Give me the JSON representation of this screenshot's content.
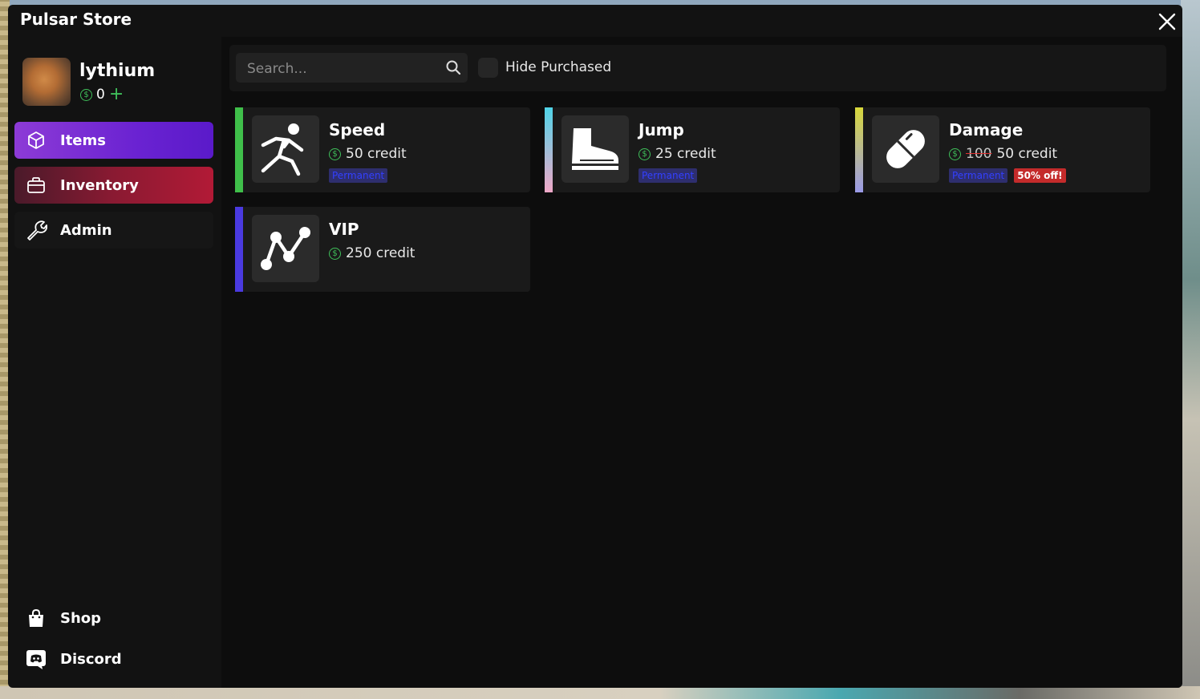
{
  "window": {
    "title": "Pulsar Store"
  },
  "profile": {
    "username": "lythium",
    "balance": "0",
    "add_symbol": "+"
  },
  "nav": {
    "items": "Items",
    "inventory": "Inventory",
    "admin": "Admin",
    "shop": "Shop",
    "discord": "Discord"
  },
  "toolbar": {
    "search_placeholder": "Search...",
    "hide_purchased_label": "Hide Purchased",
    "hide_purchased_checked": false
  },
  "items": [
    {
      "name": "Speed",
      "price": "50 credit",
      "tag": "Permanent",
      "icon": "running-figure-icon",
      "accent": "#3fbf4a"
    },
    {
      "name": "Jump",
      "price": "25 credit",
      "tag": "Permanent",
      "icon": "boot-icon",
      "accent": "#4fd4e8"
    },
    {
      "name": "Damage",
      "old_price": "100",
      "price": "50 credit",
      "tag": "Permanent",
      "sale": "50% off!",
      "icon": "pill-icon",
      "accent": "#d8d83a"
    },
    {
      "name": "VIP",
      "price": "250 credit",
      "icon": "chart-line-icon",
      "accent": "#4a3ae0"
    }
  ],
  "colors": {
    "items_nav": "#6b23d2",
    "inventory_nav": "#b21a36",
    "currency": "#3fbf5a",
    "tag_text": "#3340ff",
    "sale_bg": "#c42b2b"
  }
}
